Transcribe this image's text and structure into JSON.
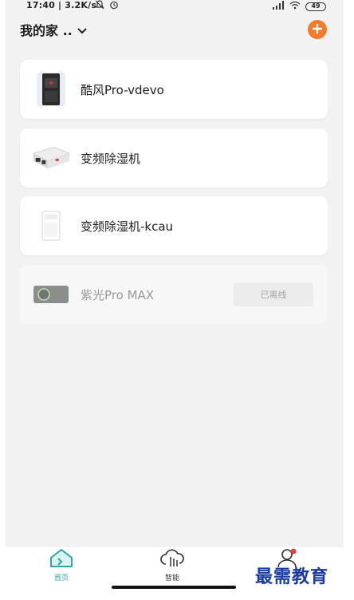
{
  "status_bar": {
    "time": "17:40 | 3.2K/s",
    "battery": "49"
  },
  "header": {
    "home_name": "我的家 ..",
    "add_icon": "plus-circle-icon"
  },
  "devices": [
    {
      "name": "酷风Pro-vdevo",
      "thumb_icon": "tower-device-icon",
      "offline": false
    },
    {
      "name": "变频除湿机",
      "thumb_icon": "dehumidifier-box-icon",
      "offline": false
    },
    {
      "name": "变频除湿机-kcau",
      "thumb_icon": "dehumidifier-tall-icon",
      "offline": false
    },
    {
      "name": "紫光Pro MAX",
      "thumb_icon": "purifier-device-icon",
      "offline": true,
      "status": "已离线"
    }
  ],
  "tabbar": {
    "tabs": [
      {
        "label": "首页",
        "icon": "home-icon",
        "active": true
      },
      {
        "label": "智能",
        "icon": "cloud-icon",
        "active": false
      },
      {
        "label": "",
        "icon": "profile-icon",
        "active": false
      }
    ]
  },
  "colors": {
    "accent": "#f47a2c",
    "active_tab": "#2fa5a6",
    "background": "#f2f2f2"
  },
  "watermark": "最需教育"
}
